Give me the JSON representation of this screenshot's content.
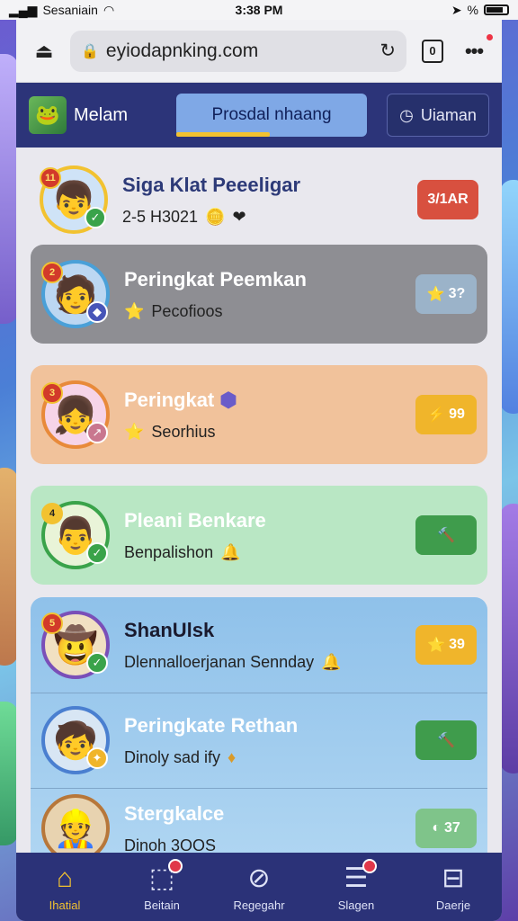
{
  "status_bar": {
    "carrier": "Sesaniain",
    "time": "3:38 PM",
    "battery_text": "%"
  },
  "browser": {
    "url": "eyiodapnking.com",
    "tab_count": "0"
  },
  "nav_tabs": {
    "brand_label": "Melam",
    "active_tab": "Prosdal nhaang",
    "right_tab": "Uiaman"
  },
  "rows": [
    {
      "name": "Siga Klat Peeeligar",
      "sub": "2-5 H3021",
      "pill": "3/1AR",
      "rank": "11"
    },
    {
      "name": "Peringkat Peemkan",
      "sub": "Pecofioos",
      "pill": "3?",
      "rank": "2"
    },
    {
      "name": "Peringkat",
      "sub": "Seorhius",
      "pill": "99",
      "rank": "3"
    },
    {
      "name": "Pleani Benkare",
      "sub": "Benpalishon",
      "pill": "",
      "rank": "4"
    },
    {
      "name": "ShanUlsk",
      "sub": "Dlennalloerjanan Sennday",
      "pill": "39",
      "rank": "5"
    },
    {
      "name": "Peringkate Rethan",
      "sub": "Dinoly sad ify",
      "pill": "",
      "rank": ""
    },
    {
      "name": "Stergkalce",
      "sub": "Dinoh 3OOS",
      "pill": "37",
      "rank": ""
    }
  ],
  "bottom_nav": [
    {
      "label": "Ihatial",
      "icon": "home-icon"
    },
    {
      "label": "Beitain",
      "icon": "cube-icon"
    },
    {
      "label": "Regegahr",
      "icon": "compass-icon"
    },
    {
      "label": "Slagen",
      "icon": "list-icon"
    },
    {
      "label": "Daerje",
      "icon": "gift-icon"
    }
  ],
  "colors": {
    "nav_bg": "#2c3479",
    "accent": "#f2c230",
    "row_gray": "#8e8e93",
    "row_orange": "#f1c29b",
    "row_green": "#b9e7c4",
    "row_blue": "#8fc1ea",
    "pill_red": "#d8503f",
    "pill_gold": "#f0b52b",
    "pill_green": "#3f9c4c"
  }
}
